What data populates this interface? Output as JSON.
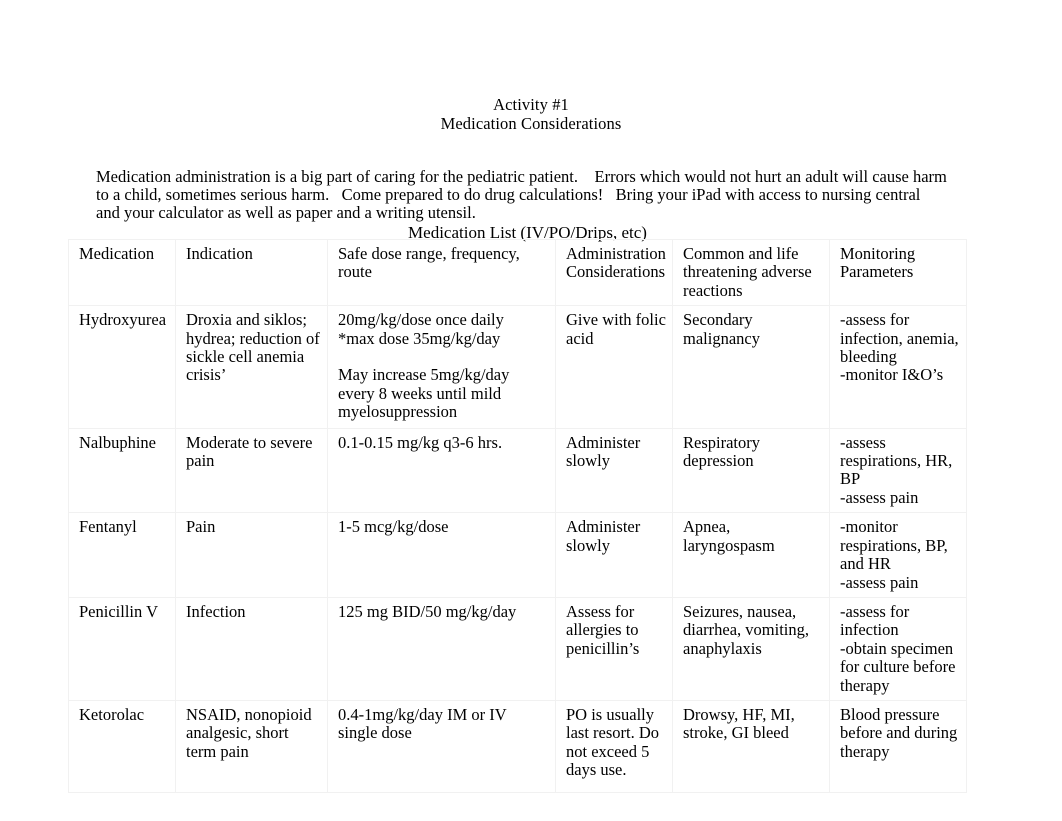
{
  "document": {
    "title_lines": [
      "Activity #1",
      "Medication Considerations"
    ],
    "intro_paragraph": "Medication administration is a big part of caring for the pediatric patient.    Errors which would not hurt an adult will cause harm to a child, sometimes serious harm.   Come prepared to do drug calculations!   Bring your iPad with access to nursing central and your calculator as well as paper and a writing utensil."
  },
  "table": {
    "caption": "Medication List (IV/PO/Drips, etc)",
    "border_color": "#f1f1f1",
    "headers": [
      "Medication",
      "Indication",
      "Safe dose range, frequency, route",
      "Administration Considerations",
      "Common and life threatening adverse reactions",
      "Monitoring Parameters"
    ],
    "rows": [
      {
        "medication": "Hydroxyurea",
        "indication": "Droxia and siklos; hydrea; reduction of sickle cell anemia crisis’",
        "dose": "20mg/kg/dose once daily\n*max dose 35mg/kg/day\n\nMay increase 5mg/kg/day every 8 weeks until mild myelosuppression",
        "administration": "Give with folic acid",
        "adverse": "Secondary malignancy",
        "monitoring": "-assess for infection, anemia, bleeding\n-monitor I&O’s"
      },
      {
        "medication": "Nalbuphine",
        "indication": "Moderate to severe pain",
        "dose": "0.1-0.15 mg/kg q3-6 hrs.",
        "administration": "Administer slowly",
        "adverse": "Respiratory depression",
        "monitoring": "-assess respirations, HR, BP\n-assess pain"
      },
      {
        "medication": "Fentanyl",
        "indication": "Pain",
        "dose": "1-5 mcg/kg/dose",
        "administration": "Administer slowly",
        "adverse": "Apnea, laryngospasm",
        "monitoring": "-monitor respirations, BP, and HR\n-assess pain"
      },
      {
        "medication": "Penicillin V",
        "indication": "Infection",
        "dose": "125 mg BID/50 mg/kg/day",
        "administration": "Assess for allergies to penicillin’s",
        "adverse": "Seizures, nausea, diarrhea, vomiting, anaphylaxis",
        "monitoring": "-assess for infection\n-obtain specimen for culture before therapy"
      },
      {
        "medication": "Ketorolac",
        "indication": "NSAID, nonopioid analgesic, short term pain",
        "dose": "0.4-1mg/kg/day IM or IV single dose",
        "administration": "PO is usually last resort. Do not exceed 5 days use.",
        "adverse": "Drowsy, HF, MI, stroke, GI bleed",
        "monitoring": "Blood pressure before and during therapy"
      }
    ]
  }
}
